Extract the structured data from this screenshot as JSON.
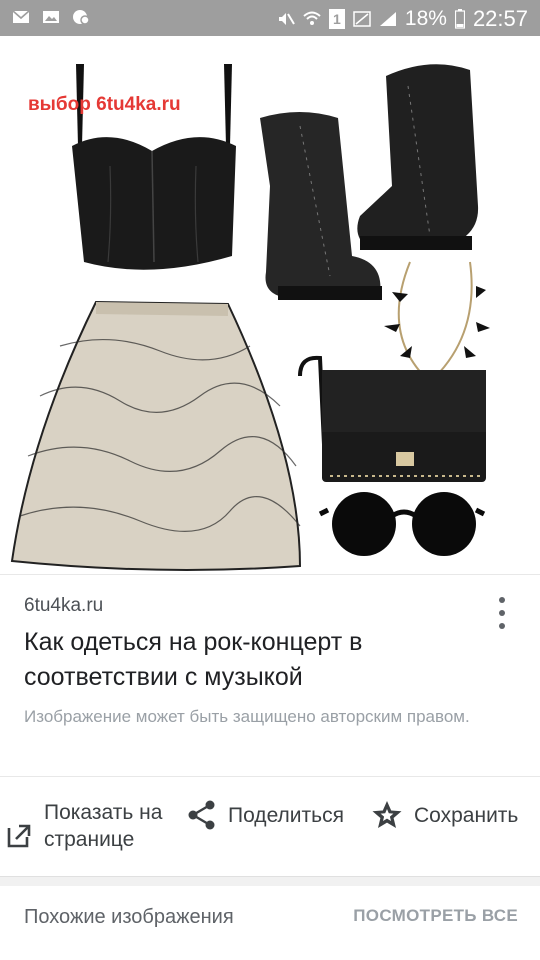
{
  "status_bar": {
    "battery": "18%",
    "time": "22:57",
    "sim_badge": "1"
  },
  "image": {
    "watermark": "выбор 6tu4ka.ru"
  },
  "result": {
    "site": "6tu4ka.ru",
    "title": "Как одеться на рок-концерт в соответствии с музыкой",
    "copyright_notice": "Изображение может быть защищено авторским правом."
  },
  "actions": {
    "show_on_page_line1": "Показать на",
    "show_on_page_line2": "странице",
    "share": "Поделиться",
    "save": "Сохранить"
  },
  "similar": {
    "title": "Похожие изображения",
    "see_all": "ПОСМОТРЕТЬ ВСЕ"
  },
  "colors": {
    "status_bar": "#9e9e9e",
    "watermark": "#e53935"
  }
}
